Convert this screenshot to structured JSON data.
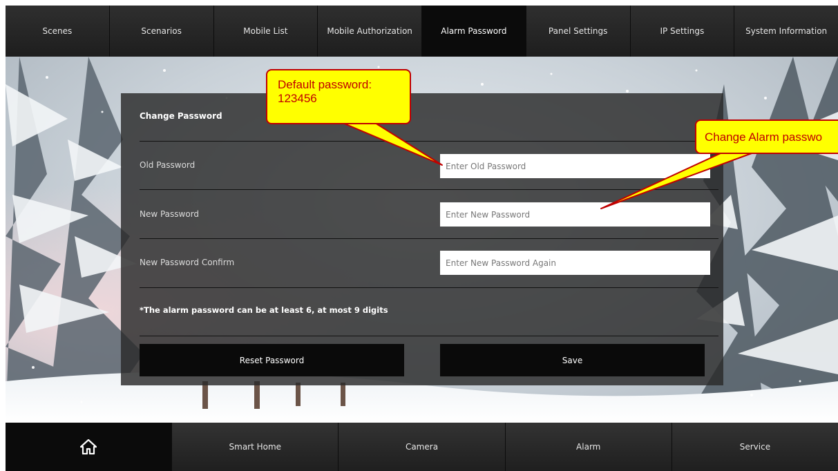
{
  "top_nav": {
    "tabs": [
      {
        "label": "Scenes"
      },
      {
        "label": "Scenarios"
      },
      {
        "label": "Mobile List"
      },
      {
        "label": "Mobile Authorization"
      },
      {
        "label": "Alarm Password",
        "active": true
      },
      {
        "label": "Panel Settings"
      },
      {
        "label": "IP Settings"
      },
      {
        "label": "System Information"
      }
    ]
  },
  "panel": {
    "title": "Change Password",
    "fields": [
      {
        "label": "Old Password",
        "placeholder": "Enter Old Password"
      },
      {
        "label": "New Password",
        "placeholder": "Enter New Password"
      },
      {
        "label": "New Password Confirm",
        "placeholder": "Enter New Password Again"
      }
    ],
    "hint": "*The alarm password can be at least 6, at most 9 digits",
    "reset_label": "Reset Password",
    "save_label": "Save"
  },
  "annotations": {
    "default_password_line1": "Default password:",
    "default_password_line2": "123456",
    "change_alarm": "Change Alarm passwo"
  },
  "bottom_nav": {
    "home_icon": "home-icon",
    "items": [
      {
        "label": "Smart Home"
      },
      {
        "label": "Camera"
      },
      {
        "label": "Alarm"
      },
      {
        "label": "Service"
      }
    ]
  },
  "colors": {
    "callout_fill": "#ffff00",
    "callout_border": "#c00000",
    "nav_active": "#0b0b0b"
  }
}
